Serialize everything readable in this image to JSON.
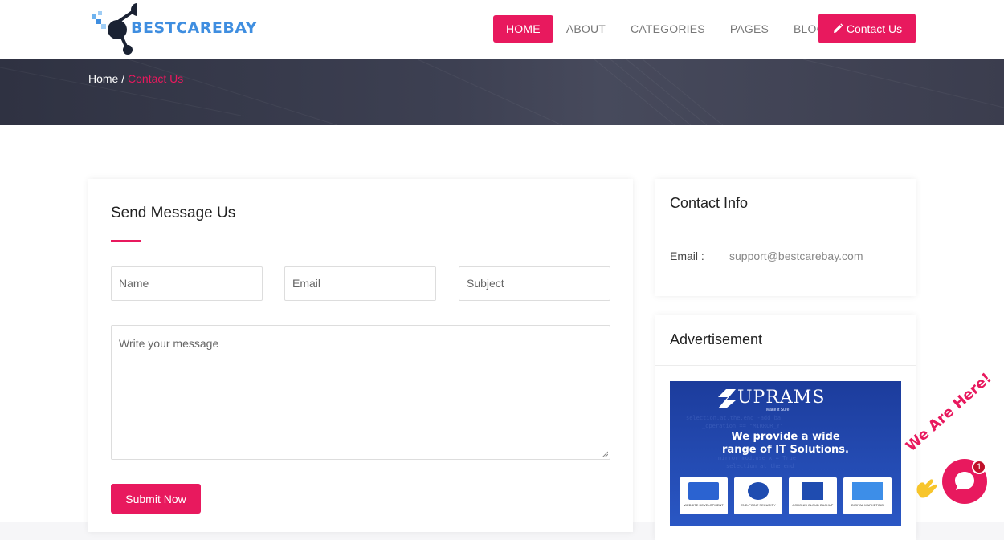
{
  "brand": {
    "logo_text": "BESTCAREBAY",
    "accent": "#e8195e",
    "logo_color": "#3f8ee0"
  },
  "nav": {
    "items": [
      {
        "label": "HOME",
        "active": true
      },
      {
        "label": "ABOUT"
      },
      {
        "label": "CATEGORIES"
      },
      {
        "label": "PAGES"
      },
      {
        "label": "BLOGS"
      }
    ],
    "contact_label": "Contact Us",
    "contact_icon": "pencil-icon"
  },
  "breadcrumb": {
    "home": "Home /",
    "current": "Contact Us"
  },
  "form": {
    "title": "Send Message Us",
    "name_placeholder": "Name",
    "email_placeholder": "Email",
    "subject_placeholder": "Subject",
    "message_placeholder": "Write your message",
    "submit_label": "Submit Now"
  },
  "contact_info": {
    "title": "Contact Info",
    "email_label": "Email :",
    "email_value": "support@bestcarebay.com"
  },
  "advertisement": {
    "title": "Advertisement",
    "brand": "UPRAMS",
    "tagline": "Make It Sure",
    "line1": "We provide a wide",
    "line2": "range of  IT Solutions.",
    "services": [
      "WEBSITE DEVELOPMENT",
      "END-POINT SECURITY",
      "ACRONIS CLOUD BACKUP",
      "DIGITAL MARKETING"
    ]
  },
  "chat": {
    "teaser": "We Are Here!",
    "badge_count": "1"
  }
}
